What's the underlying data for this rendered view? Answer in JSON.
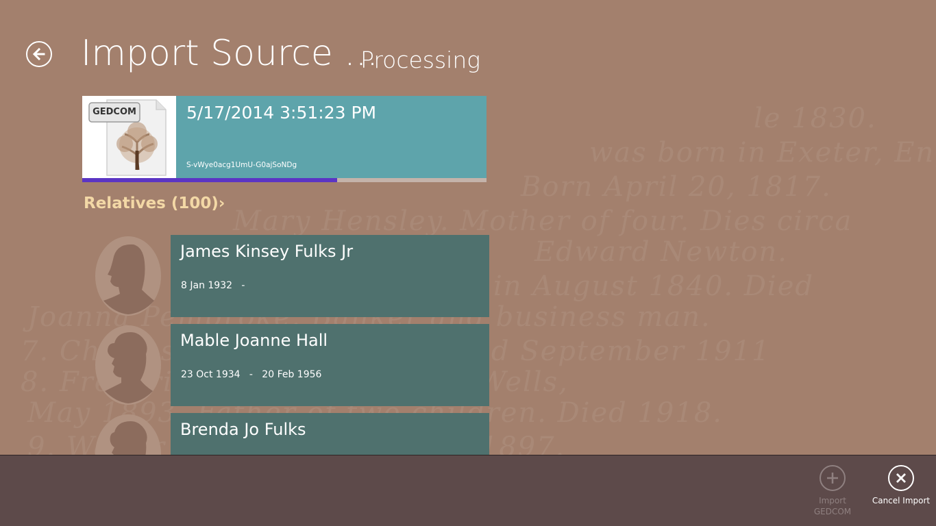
{
  "header": {
    "title": "Import Source ...",
    "subtitle": "Processing"
  },
  "source": {
    "badge_text": "GEDCOM",
    "date": "5/17/2014 3:51:23 PM",
    "id": "S-vWye0acg1UmU-G0ajSoNDg",
    "progress": 0.63
  },
  "relatives": {
    "heading": "Relatives  (100)›",
    "items": [
      {
        "name": "James Kinsey Fulks Jr",
        "dates": "8 Jan 1932   -",
        "avatar": "male-silhouette"
      },
      {
        "name": "Mable Joanne Hall",
        "dates": "23 Oct 1934   -   20 Feb 1956",
        "avatar": "female-silhouette"
      },
      {
        "name": "Brenda Jo Fulks",
        "dates": "",
        "avatar": "female-silhouette"
      }
    ]
  },
  "app_bar": {
    "import_label": "Import GEDCOM",
    "cancel_label": "Cancel Import"
  },
  "colors": {
    "background": "#a3806d",
    "source_tile": "#5ea4ab",
    "relative_tile": "#4f716e",
    "section_heading": "#f3d8a6",
    "progress_fill": "#5b35c4",
    "app_bar": "#5d4a4a"
  }
}
